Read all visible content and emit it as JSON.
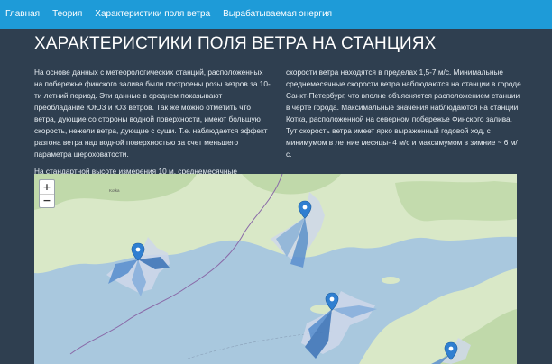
{
  "nav": {
    "items": [
      "Главная",
      "Теория",
      "Характеристики поля ветра",
      "Вырабатываемая энергия"
    ]
  },
  "page": {
    "title": "ХАРАКТЕРИСТИКИ ПОЛЯ ВЕТРА НА СТАНЦИЯХ",
    "paragraph_1": "На основе данных с метеорологических станций, расположенных на побережье финского залива были построены розы ветров за 10-ти летний период. Эти данные в среднем показывают преобладание ЮЮЗ и ЮЗ ветров. Так же можно отметить что ветра, дующие со стороны водной поверхности, имеют большую скорость, нежели ветра, дующие с суши. Т.е. наблюдается эффект разгона ветра над водной поверхностью за счет меньшего параметра шероховатости.",
    "paragraph_2": "На стандартной высоте измерения 10 м, среднемесячные",
    "paragraph_3": "скорости ветра находятся в пределах 1,5-7 м/с. Минимальные среднемесячные скорости ветра наблюдаются на станции в городе Санкт-Петербург, что вполне объясняется расположением станции в черте города. Максимальные значения наблюдаются на станции Котка, расположенной на северном побережье Финского залива. Тут скорость ветра имеет ярко выраженный годовой ход, с минимумом в летние месяцы- 4 м/с и максимумом в зимние ~ 6 м/с."
  },
  "map": {
    "zoom_in": "+",
    "zoom_out": "−",
    "place_label": "Kotka",
    "colors": {
      "water": "#a9c8de",
      "land": "#d9e8c7",
      "forest": "#b9d5a2",
      "rose": "#5b8fcf",
      "marker": "#2f7fd1"
    },
    "icons": [
      "map-marker-icon"
    ]
  }
}
